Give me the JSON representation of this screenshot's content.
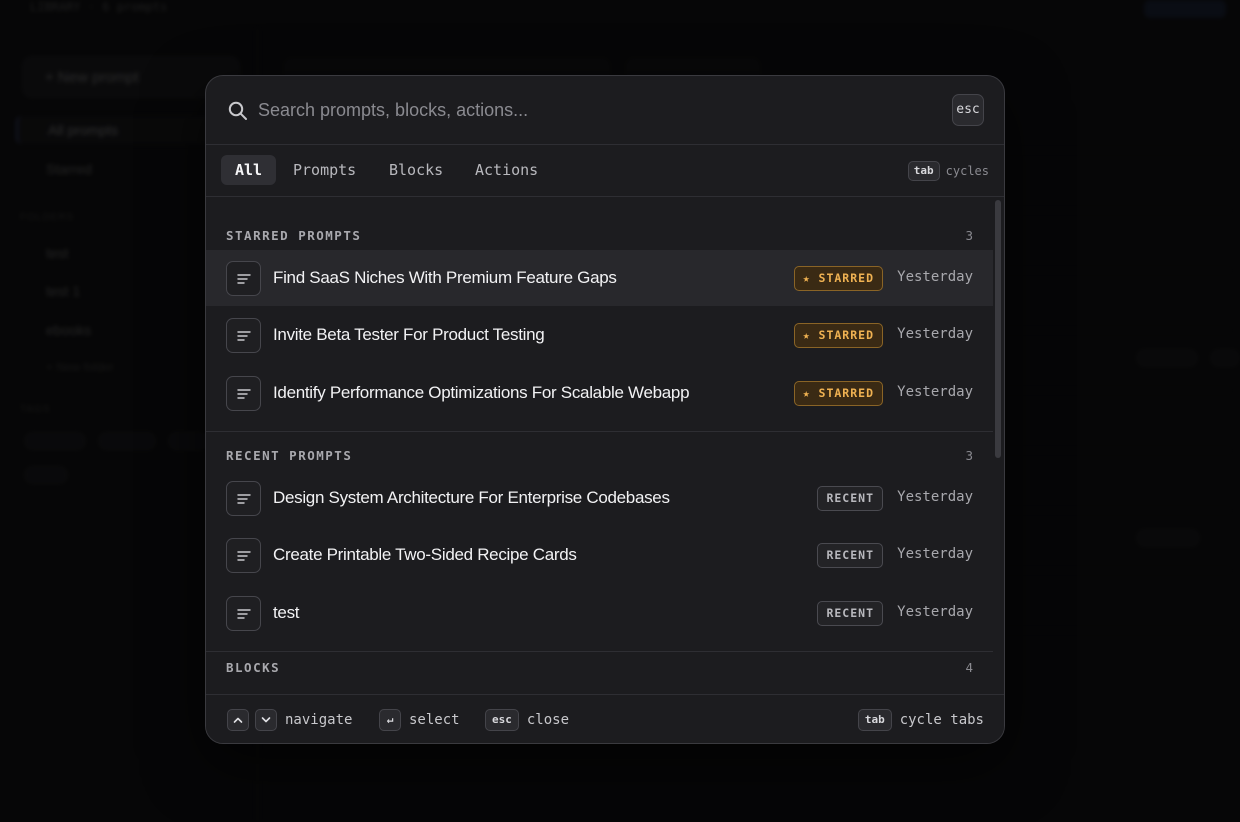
{
  "background": {
    "breadcrumb": "LIBRARY · 6 prompts",
    "new_prompt_label": "+ New prompt",
    "nav": [
      "All prompts",
      "Starred"
    ],
    "folders_label": "FOLDERS",
    "folders": [
      "test",
      "test 1",
      "ebooks"
    ],
    "new_folder_label": "+ New folder",
    "tags_label": "TAGS"
  },
  "search": {
    "placeholder": "Search prompts, blocks, actions...",
    "value": "",
    "esc_key": "esc"
  },
  "tabs": [
    {
      "label": "All",
      "active": true
    },
    {
      "label": "Prompts",
      "active": false
    },
    {
      "label": "Blocks",
      "active": false
    },
    {
      "label": "Actions",
      "active": false
    }
  ],
  "tab_hint": {
    "key": "tab",
    "text": "cycles"
  },
  "sections": [
    {
      "title": "STARRED PROMPTS",
      "count": "3",
      "items": [
        {
          "title": "Find SaaS Niches With Premium Feature Gaps",
          "badge": "★ STARRED",
          "badge_type": "starred",
          "date": "Yesterday"
        },
        {
          "title": "Invite Beta Tester For Product Testing",
          "badge": "★ STARRED",
          "badge_type": "starred",
          "date": "Yesterday"
        },
        {
          "title": "Identify Performance Optimizations For Scalable Webapp",
          "badge": "★ STARRED",
          "badge_type": "starred",
          "date": "Yesterday"
        }
      ]
    },
    {
      "title": "RECENT PROMPTS",
      "count": "3",
      "items": [
        {
          "title": "Design System Architecture For Enterprise Codebases",
          "badge": "RECENT",
          "badge_type": "recent",
          "date": "Yesterday"
        },
        {
          "title": "Create Printable Two-Sided Recipe Cards",
          "badge": "RECENT",
          "badge_type": "recent",
          "date": "Yesterday"
        },
        {
          "title": "test",
          "badge": "RECENT",
          "badge_type": "recent",
          "date": "Yesterday"
        }
      ]
    },
    {
      "title": "BLOCKS",
      "count": "4",
      "items": []
    }
  ],
  "footer": {
    "navigate_label": "navigate",
    "select_key": "↵",
    "select_label": "select",
    "close_key": "esc",
    "close_label": "close",
    "cycle_key": "tab",
    "cycle_label": "cycle tabs"
  },
  "colors": {
    "starred_accent": "#f0b252",
    "panel_bg": "#1c1c1f",
    "highlight_row": "#28282c"
  }
}
